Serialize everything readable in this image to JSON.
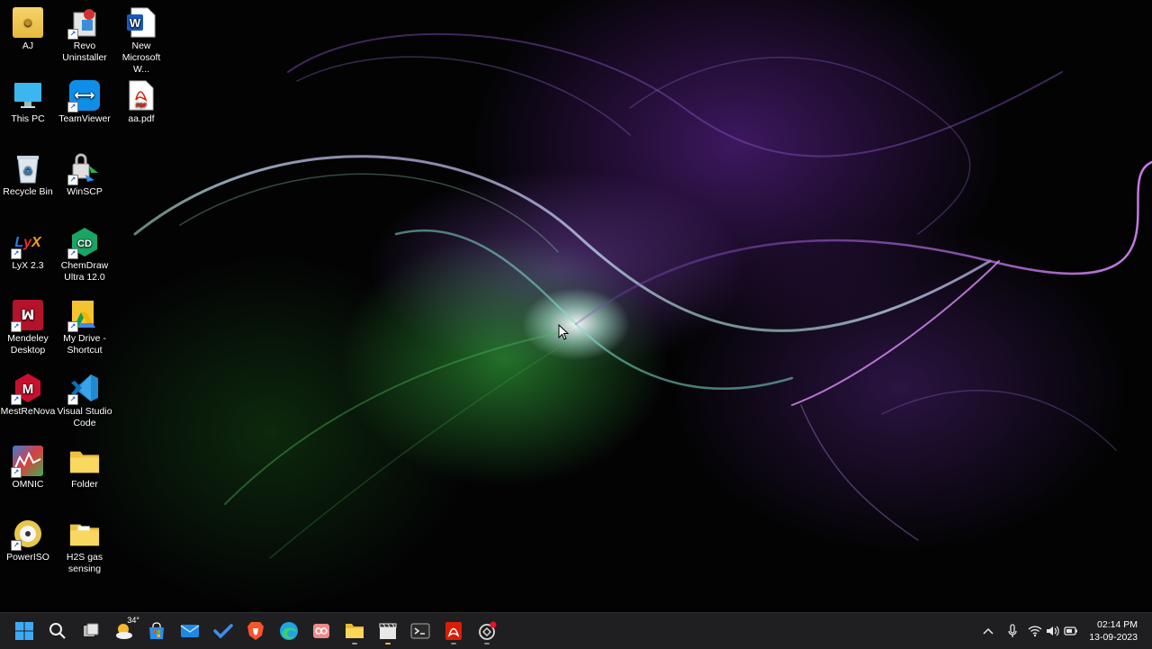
{
  "desktop_icons": [
    {
      "name": "aj",
      "label": "AJ",
      "icon": "folder-user-icon"
    },
    {
      "name": "revo-uninstaller",
      "label": "Revo Uninstaller",
      "icon": "revo-uninstaller-icon"
    },
    {
      "name": "new-word-doc",
      "label": "New Microsoft W...",
      "icon": "word-document-icon"
    },
    {
      "name": "this-pc",
      "label": "This PC",
      "icon": "monitor-icon"
    },
    {
      "name": "teamviewer",
      "label": "TeamViewer",
      "icon": "teamviewer-icon"
    },
    {
      "name": "aa-pdf",
      "label": "aa.pdf",
      "icon": "pdf-file-icon"
    },
    {
      "name": "recycle-bin",
      "label": "Recycle Bin",
      "icon": "recycle-bin-icon"
    },
    {
      "name": "winscp",
      "label": "WinSCP",
      "icon": "winscp-icon"
    },
    {
      "name": "lyx",
      "label": "LyX 2.3",
      "icon": "lyx-icon"
    },
    {
      "name": "chemdraw",
      "label": "ChemDraw Ultra 12.0",
      "icon": "chemdraw-icon"
    },
    {
      "name": "mendeley",
      "label": "Mendeley Desktop",
      "icon": "mendeley-icon"
    },
    {
      "name": "my-drive",
      "label": "My Drive - Shortcut",
      "icon": "google-drive-icon"
    },
    {
      "name": "mestrenova",
      "label": "MestReNova",
      "icon": "mestrenova-icon"
    },
    {
      "name": "vscode",
      "label": "Visual Studio Code",
      "icon": "vscode-icon"
    },
    {
      "name": "omnic",
      "label": "OMNIC",
      "icon": "omnic-icon"
    },
    {
      "name": "folder",
      "label": "Folder",
      "icon": "folder-icon"
    },
    {
      "name": "poweriso",
      "label": "PowerISO",
      "icon": "poweriso-icon"
    },
    {
      "name": "h2s-gas-sensing",
      "label": "H2S gas sensing",
      "icon": "folder-icon"
    }
  ],
  "taskbar": {
    "weather_temp": "34°",
    "apps": [
      {
        "name": "start",
        "icon": "windows-logo-icon"
      },
      {
        "name": "search",
        "icon": "search-icon"
      },
      {
        "name": "task-view",
        "icon": "task-view-icon"
      },
      {
        "name": "weather",
        "icon": "weather-sun-cloud-icon"
      },
      {
        "name": "microsoft-store",
        "icon": "store-icon"
      },
      {
        "name": "mail",
        "icon": "mail-icon"
      },
      {
        "name": "todo",
        "icon": "todo-check-icon"
      },
      {
        "name": "brave",
        "icon": "brave-browser-icon"
      },
      {
        "name": "edge",
        "icon": "edge-browser-icon"
      },
      {
        "name": "snipping-tool",
        "icon": "snipping-tool-icon"
      },
      {
        "name": "file-explorer",
        "icon": "file-explorer-icon"
      },
      {
        "name": "video-editor",
        "icon": "clapperboard-icon"
      },
      {
        "name": "terminal",
        "icon": "terminal-icon"
      },
      {
        "name": "acrobat",
        "icon": "acrobat-icon"
      },
      {
        "name": "openai-chat",
        "icon": "chatgpt-icon"
      }
    ]
  },
  "tray": {
    "time": "02:14 PM",
    "date": "13-09-2023"
  },
  "colors": {
    "taskbar_bg": "#1f1f21",
    "accent_blue": "#2f8cf0"
  }
}
